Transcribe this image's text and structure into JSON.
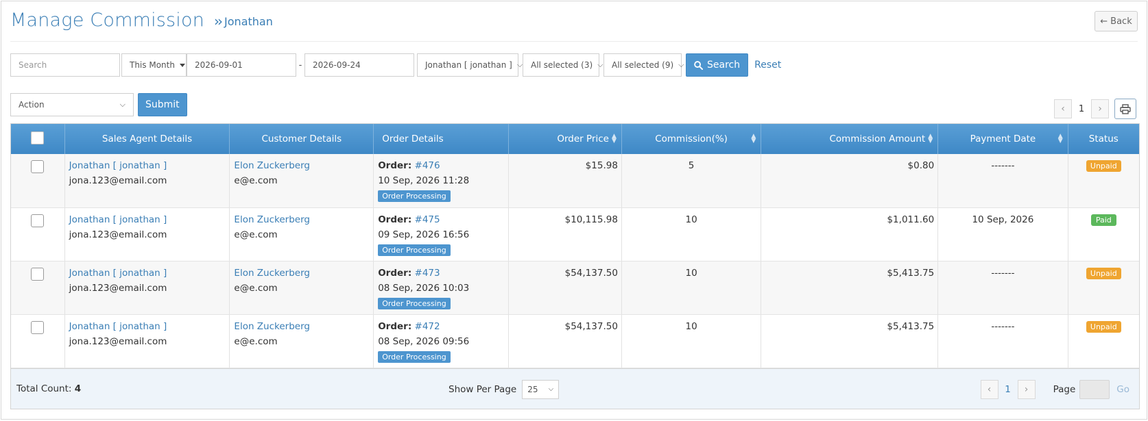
{
  "header": {
    "title": "Manage Commission",
    "breadcrumb": "Jonathan",
    "back_label": "Back"
  },
  "filters": {
    "search_placeholder": "Search",
    "period": "This Month",
    "date_from": "2026-09-01",
    "date_to": "2026-09-24",
    "agent": "Jonathan [ jonathan ]",
    "filter_a": "All selected (3)",
    "filter_b": "All selected (9)",
    "search_label": "Search",
    "reset_label": "Reset"
  },
  "actions": {
    "action_select": "Action",
    "submit_label": "Submit"
  },
  "top_pager": {
    "page": "1"
  },
  "table": {
    "columns": [
      "Sales Agent Details",
      "Customer Details",
      "Order Details",
      "Order Price",
      "Commission(%)",
      "Commission Amount",
      "Payment Date",
      "Status"
    ],
    "order_prefix": "Order",
    "rows": [
      {
        "agent": "Jonathan [ jonathan ]",
        "agent_email": "jona.123@email.com",
        "customer": "Elon Zuckerberg",
        "customer_email": "e@e.com",
        "order_no": "#476",
        "order_date": "10 Sep, 2026 11:28",
        "order_status": "Order Processing",
        "price": "$15.98",
        "commission_pct": "5",
        "commission_amount": "$0.80",
        "payment_date": "-------",
        "status": "Unpaid"
      },
      {
        "agent": "Jonathan [ jonathan ]",
        "agent_email": "jona.123@email.com",
        "customer": "Elon Zuckerberg",
        "customer_email": "e@e.com",
        "order_no": "#475",
        "order_date": "09 Sep, 2026 16:56",
        "order_status": "Order Processing",
        "price": "$10,115.98",
        "commission_pct": "10",
        "commission_amount": "$1,011.60",
        "payment_date": "10 Sep, 2026",
        "status": "Paid"
      },
      {
        "agent": "Jonathan [ jonathan ]",
        "agent_email": "jona.123@email.com",
        "customer": "Elon Zuckerberg",
        "customer_email": "e@e.com",
        "order_no": "#473",
        "order_date": "08 Sep, 2026 10:03",
        "order_status": "Order Processing",
        "price": "$54,137.50",
        "commission_pct": "10",
        "commission_amount": "$5,413.75",
        "payment_date": "-------",
        "status": "Unpaid"
      },
      {
        "agent": "Jonathan [ jonathan ]",
        "agent_email": "jona.123@email.com",
        "customer": "Elon Zuckerberg",
        "customer_email": "e@e.com",
        "order_no": "#472",
        "order_date": "08 Sep, 2026 09:56",
        "order_status": "Order Processing",
        "price": "$54,137.50",
        "commission_pct": "10",
        "commission_amount": "$5,413.75",
        "payment_date": "-------",
        "status": "Unpaid"
      }
    ]
  },
  "footer": {
    "total_label": "Total Count:",
    "total_value": "4",
    "per_page_label": "Show Per Page",
    "per_page_value": "25",
    "page": "1",
    "page_label": "Page",
    "go_label": "Go"
  },
  "colors": {
    "accent": "#3a7eb5",
    "header_blue": "#4d95cf",
    "unpaid": "#efa531",
    "paid": "#5cb85c"
  }
}
